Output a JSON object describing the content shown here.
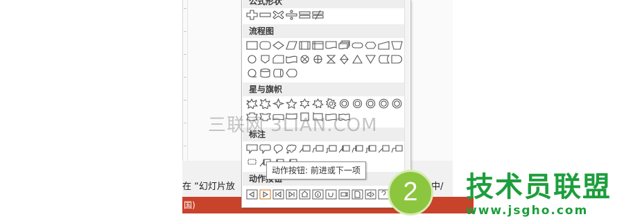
{
  "app": {
    "instruction_text": "在 “幻灯片放",
    "instruction_tail": "中/",
    "status_text": "国)"
  },
  "shapes_panel": {
    "sections": [
      {
        "title": "公式形状"
      },
      {
        "title": "流程图"
      },
      {
        "title": "星与旗帜"
      },
      {
        "title": "标注"
      },
      {
        "title": "动作按钮"
      }
    ]
  },
  "tooltip": {
    "text": "动作按钮: 前进或下一项"
  },
  "step_badge": {
    "number": "2"
  },
  "watermarks": {
    "cn_text": "三联网 3LIAN.COM",
    "logo_text": "技术员联盟",
    "logo_url": "www.jsgho.com"
  },
  "colors": {
    "status_bar": "#c8432a",
    "badge": "#8cc63f",
    "logo": "#1d9e3c"
  }
}
